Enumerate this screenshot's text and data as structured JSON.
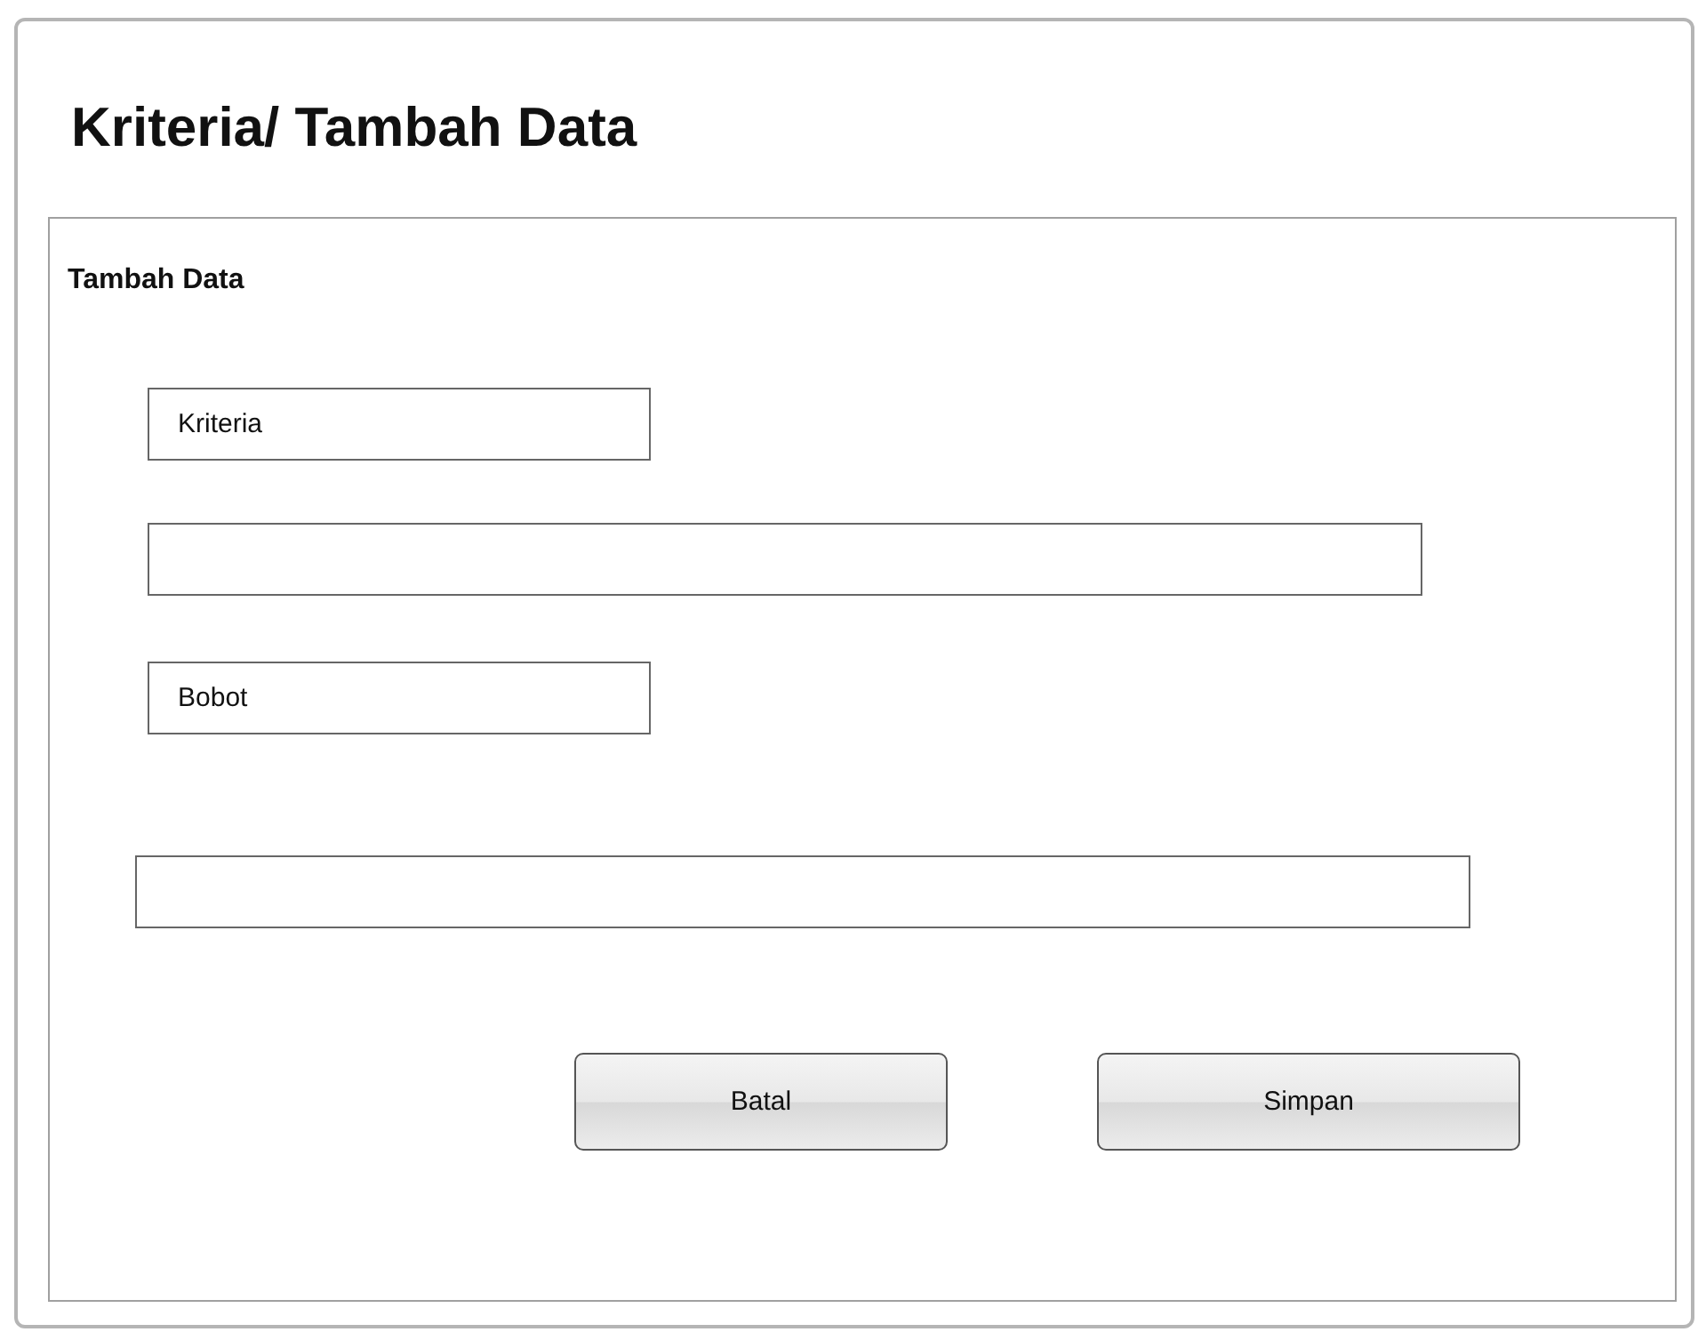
{
  "window": {
    "title": "Kriteria/ Tambah Data"
  },
  "panel": {
    "title": "Tambah Data",
    "fields": [
      {
        "label": "Kriteria"
      },
      {
        "label": "Bobot"
      }
    ]
  },
  "buttons": [
    {
      "label": "Batal"
    },
    {
      "label": "Simpan"
    }
  ]
}
